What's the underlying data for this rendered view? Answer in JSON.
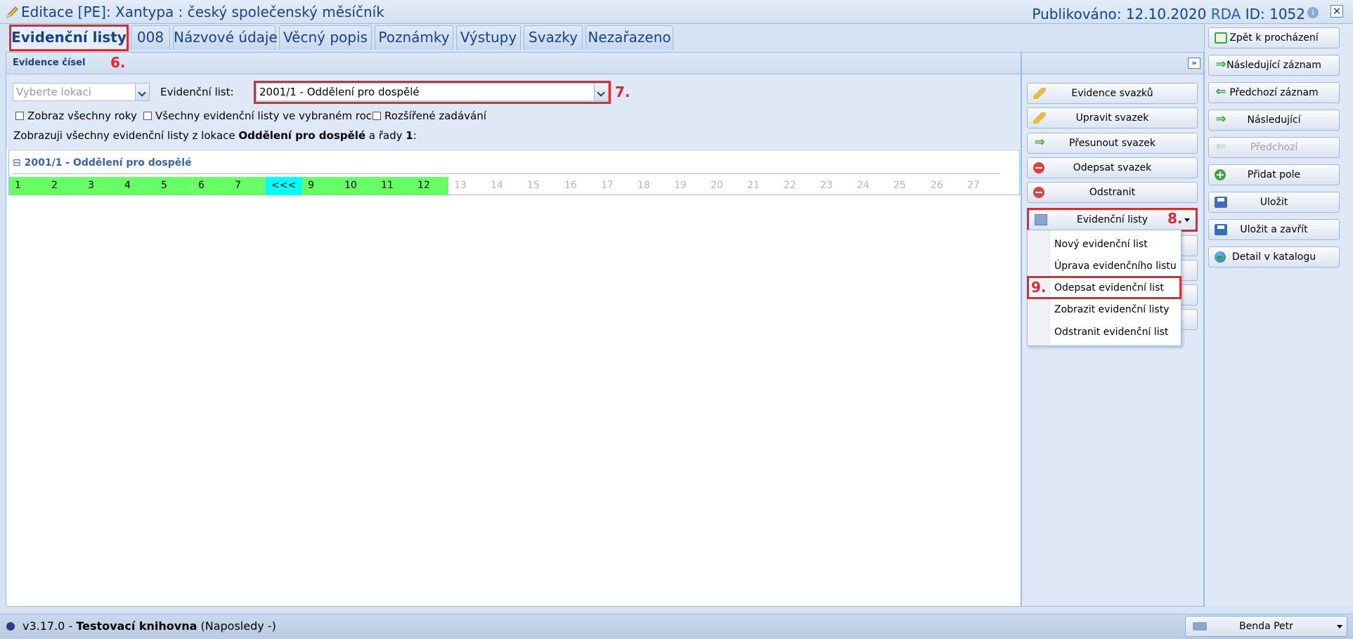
{
  "window": {
    "title": "Editace [PE]: Xantypa : český společenský měsíčník",
    "published_label": "Publikováno: 12.10.2020",
    "rda_label": "RDA",
    "id_label": "ID: 1052"
  },
  "tabs": [
    {
      "label": "Evidenční listy",
      "active": true
    },
    {
      "label": "008"
    },
    {
      "label": "Názvové údaje"
    },
    {
      "label": "Věcný popis"
    },
    {
      "label": "Poznámky"
    },
    {
      "label": "Výstupy"
    },
    {
      "label": "Svazky"
    },
    {
      "label": "Nezařazeno"
    }
  ],
  "annotations": {
    "a6": "6.",
    "a7": "7.",
    "a8": "8.",
    "a9": "9."
  },
  "panel": {
    "title": "Evidence čísel",
    "location_placeholder": "Vyberte lokaci",
    "record_label": "Evidenční list:",
    "record_value": "2001/1 - Oddělení pro dospělé",
    "check_all_years": "Zobraz všechny roky",
    "check_all_lists": "Všechny evidenční listy ve vybraném roce",
    "check_extended": "Rozšířené zadávání",
    "info_prefix": "Zobrazuji všechny evidenční listy z lokace ",
    "info_location": "Oddělení pro dospělé",
    "info_mid": " a řady ",
    "info_series": "1",
    "info_suffix": ":",
    "group_title": "2001/1 - Oddělení pro dospělé",
    "group_toggle": "⊟"
  },
  "issues": [
    {
      "label": "1",
      "state": "done"
    },
    {
      "label": "2",
      "state": "done"
    },
    {
      "label": "3",
      "state": "done"
    },
    {
      "label": "4",
      "state": "done"
    },
    {
      "label": "5",
      "state": "done"
    },
    {
      "label": "6",
      "state": "done"
    },
    {
      "label": "7",
      "state": "done"
    },
    {
      "label": "<<<",
      "state": "cyan"
    },
    {
      "label": "9",
      "state": "done"
    },
    {
      "label": "10",
      "state": "done"
    },
    {
      "label": "11",
      "state": "done"
    },
    {
      "label": "12",
      "state": "done"
    },
    {
      "label": "13",
      "state": "empty"
    },
    {
      "label": "14",
      "state": "empty"
    },
    {
      "label": "15",
      "state": "empty"
    },
    {
      "label": "16",
      "state": "empty"
    },
    {
      "label": "17",
      "state": "empty"
    },
    {
      "label": "18",
      "state": "empty"
    },
    {
      "label": "19",
      "state": "empty"
    },
    {
      "label": "20",
      "state": "empty"
    },
    {
      "label": "21",
      "state": "empty"
    },
    {
      "label": "22",
      "state": "empty"
    },
    {
      "label": "23",
      "state": "empty"
    },
    {
      "label": "24",
      "state": "empty"
    },
    {
      "label": "25",
      "state": "empty"
    },
    {
      "label": "26",
      "state": "empty"
    },
    {
      "label": "27",
      "state": "empty"
    }
  ],
  "actions": {
    "evidence_svazku": "Evidence svazků",
    "upravit_svazek": "Upravit svazek",
    "presunout_svazek": "Přesunout svazek",
    "odepsat_svazek": "Odepsat svazek",
    "odstranit": "Odstranit",
    "evidencni_listy": "Evidenční listy"
  },
  "menu": {
    "novy": "Nový evidenční list",
    "uprava": "Úprava evidenčního listu",
    "odepsat": "Odepsat evidenční list",
    "zobrazit": "Zobrazit evidenční listy",
    "odstranit": "Odstranit evidenční list"
  },
  "navigation": {
    "zpet": "Zpět k procházení",
    "nasledujici_zaznam": "Následující záznam",
    "predchozi_zaznam": "Předchozí záznam",
    "nasledujici": "Následující",
    "predchozi": "Předchozí",
    "pridat_pole": "Přidat pole",
    "ulozit": "Uložit",
    "ulozit_zavrit": "Uložit a zavřít",
    "detail": "Detail v katalogu"
  },
  "status": {
    "version": "v3.17.0 - ",
    "library": "Testovací knihovna",
    "last": " (Naposledy -)",
    "user": "Benda Petr"
  },
  "colors": {
    "done": "#66ff66",
    "current": "#00ffff",
    "highlight": "#e0282e",
    "accent": "#15428b"
  }
}
